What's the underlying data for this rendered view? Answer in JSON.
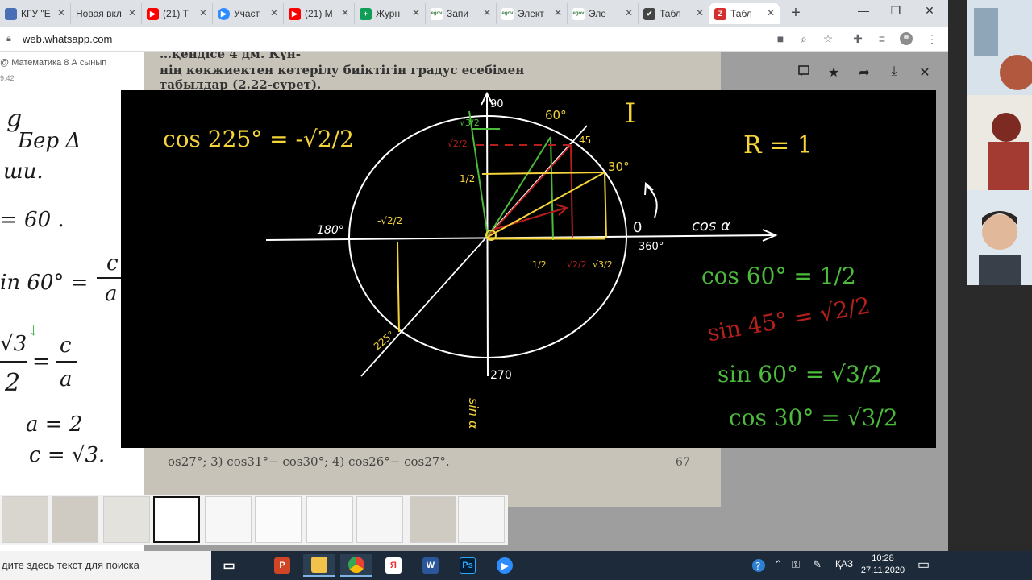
{
  "browser": {
    "tabs": [
      {
        "title": "КГУ \"Е",
        "favicon_color": "#4a6fb5",
        "favicon_glyph": ""
      },
      {
        "title": "Новая вкл",
        "favicon_color": "",
        "favicon_glyph": ""
      },
      {
        "title": "(21) Т",
        "favicon_color": "#ff0000",
        "favicon_glyph": "▶"
      },
      {
        "title": "Участ",
        "favicon_color": "#2d8cff",
        "favicon_glyph": "▶"
      },
      {
        "title": "(21) М",
        "favicon_color": "#ff0000",
        "favicon_glyph": "▶"
      },
      {
        "title": "Журн",
        "favicon_color": "#0f9d58",
        "favicon_glyph": "+"
      },
      {
        "title": "Запи",
        "favicon_color": "#3a7d44",
        "favicon_glyph": "egov"
      },
      {
        "title": "Элект",
        "favicon_color": "#3a7d44",
        "favicon_glyph": "egov"
      },
      {
        "title": "Эле",
        "favicon_color": "#3a7d44",
        "favicon_glyph": "egov"
      },
      {
        "title": "Табл",
        "favicon_color": "#444444",
        "favicon_glyph": "✔"
      },
      {
        "title": "Табл",
        "favicon_color": "#d32f2f",
        "favicon_glyph": "Z"
      }
    ],
    "new_tab": "+",
    "url": "web.whatsapp.com",
    "window_controls": {
      "minimize": "—",
      "maximize": "❐",
      "close": "✕"
    }
  },
  "chat": {
    "title": "@ Математика 8 А сынып",
    "time": "9:42"
  },
  "handwriting": {
    "l1": "g",
    "l2": "Бер Δ",
    "l3": "ши.",
    "l4": "= 60 .",
    "l5": "in 60° =",
    "l6": "c",
    "l7": "a",
    "l8": "√3",
    "l9": "2",
    "l10": "=",
    "l11": "c",
    "l12": "a",
    "l13": "a = 2",
    "l14": "c = √3."
  },
  "book": {
    "line1": "нің көкжиектен көтерілу биіктігін градус есебімен",
    "line2": "табылдар (2.22-сурет).",
    "line0": "…қендісе 4 дм. Күн-",
    "bottom": "os27°; 3) cos31°− cos30°; 4) cos26°− cos27°.",
    "page_number": "67"
  },
  "board": {
    "equation_main": "cos 225° = -√2/2",
    "radius_label": "R = 1",
    "quadrant": "I",
    "axis_x_label": "cos α",
    "axis_y_label": "sin α",
    "deg_90": "90",
    "deg_180": "180°",
    "deg_270": "270",
    "deg_360": "360°",
    "deg_0": "0",
    "deg_60": "60°",
    "deg_45": "45",
    "deg_30": "30°",
    "deg_225": "225°",
    "lbl_sqrt3_2": "√3/2",
    "lbl_sqrt2_2": "√2/2",
    "lbl_half": "1/2",
    "lbl_neg_sqrt2_2": "-√2/2",
    "eq_cos60": "cos 60° = 1/2",
    "eq_sin45": "sin 45° = √2/2",
    "eq_sin60": "sin 60° = √3/2",
    "eq_cos30": "cos 30° = √3/2"
  },
  "viewer_actions": [
    "comment-icon",
    "star-icon",
    "forward-icon",
    "download-icon",
    "close-icon"
  ],
  "taskbar": {
    "search_placeholder": "дите здесь текст для поиска",
    "lang": "ҚАЗ",
    "time": "10:28",
    "date": "27.11.2020"
  },
  "colors": {
    "yellow": "#f5d33a",
    "green": "#4cbb3c",
    "red": "#b5201c",
    "white": "#ffffff"
  }
}
